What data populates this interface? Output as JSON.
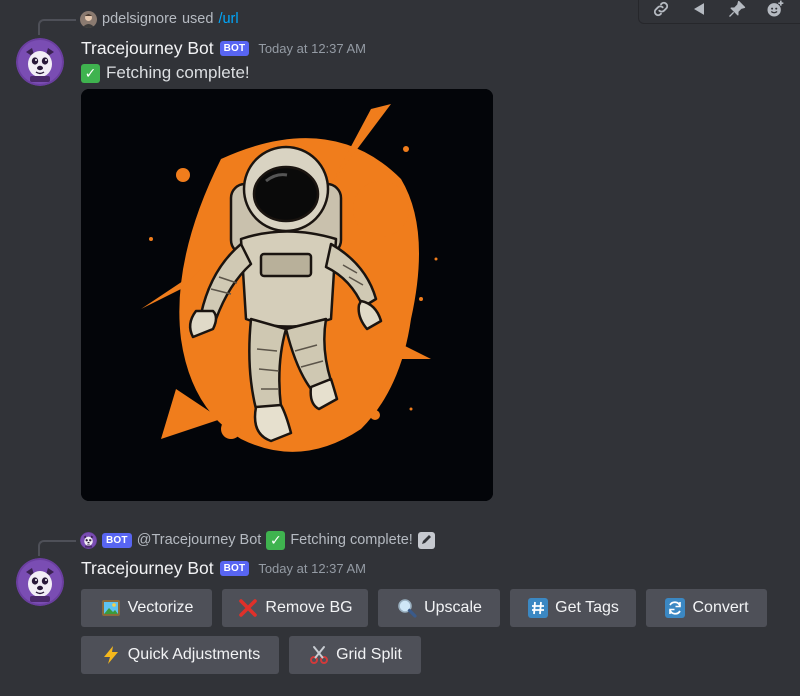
{
  "colors": {
    "background": "#313338",
    "bot_badge": "#5865f2",
    "button": "#4e5058",
    "link": "#00a8fc",
    "timestamp": "#949ba4"
  },
  "hover_toolbar": {
    "icons": [
      "link-icon",
      "reply-icon",
      "pin-icon",
      "add-reaction-icon"
    ]
  },
  "message1": {
    "reply_ref": {
      "user": "pdelsignore",
      "used_text": "used",
      "command": "/url"
    },
    "author": "Tracejourney Bot",
    "badge": "BOT",
    "timestamp": "Today at 12:37 AM",
    "text": "Fetching complete!",
    "text_emoji": "check-mark-emoji",
    "image": "astronaut-illustration"
  },
  "message2": {
    "reply_ref": {
      "badge": "BOT",
      "mention": "@Tracejourney Bot",
      "text": "Fetching complete!",
      "icons": [
        "bot-avatar-icon",
        "check-mark-emoji",
        "edit-pencil-icon"
      ]
    },
    "author": "Tracejourney Bot",
    "badge": "BOT",
    "timestamp": "Today at 12:37 AM",
    "buttons": [
      {
        "label": "Vectorize",
        "icon": "picture-frame-icon"
      },
      {
        "label": "Remove BG",
        "icon": "red-x-icon"
      },
      {
        "label": "Upscale",
        "icon": "magnifier-icon"
      },
      {
        "label": "Get Tags",
        "icon": "hash-icon"
      },
      {
        "label": "Convert",
        "icon": "refresh-icon"
      },
      {
        "label": "Quick Adjustments",
        "icon": "lightning-icon"
      },
      {
        "label": "Grid Split",
        "icon": "scissors-icon"
      }
    ]
  }
}
